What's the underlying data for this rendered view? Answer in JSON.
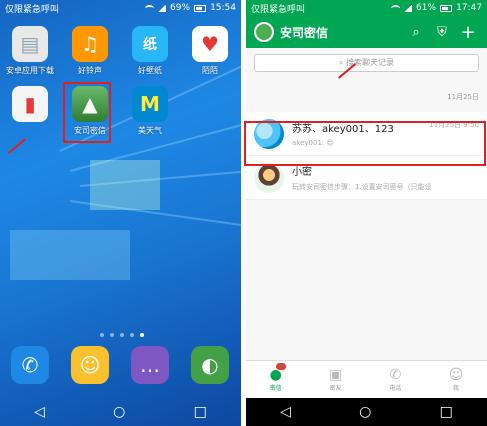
{
  "left": {
    "status": {
      "carrier": "仅限紧急呼叫",
      "battery": "69%",
      "time": "15:54"
    },
    "apps": [
      {
        "label": "安卓应用下载",
        "icon": "bag-icon",
        "color": "#e8e8e8"
      },
      {
        "label": "好铃声",
        "icon": "music-note-icon",
        "color": "#ff9800"
      },
      {
        "label": "好壁纸",
        "icon": "wallpaper-icon",
        "color": "#29b6f6"
      },
      {
        "label": "陌陌",
        "icon": "heart-icon",
        "color": "#ffffff"
      },
      {
        "label": "",
        "icon": "partial-icon",
        "color": "#f5f5f5"
      },
      {
        "label": "安司密信",
        "icon": "anzu-icon",
        "color": "#4caf50"
      },
      {
        "label": "美天气",
        "icon": "weather-icon",
        "color": "#0288d1"
      }
    ],
    "dock": [
      {
        "name": "dialer",
        "icon": "phone-icon",
        "color": "#1e88e5"
      },
      {
        "name": "contacts",
        "icon": "contacts-icon",
        "color": "#fbc02d"
      },
      {
        "name": "messages",
        "icon": "message-icon",
        "color": "#7e57c2"
      },
      {
        "name": "browser",
        "icon": "browser-icon",
        "color": "#43a047"
      }
    ],
    "page_dots": 5,
    "active_dot": 4
  },
  "right": {
    "status": {
      "carrier": "仅限紧急呼叫",
      "battery": "61%",
      "time": "17:47"
    },
    "app_title": "安司密信",
    "search_placeholder": "搜索聊天记录",
    "date_hint": "11月25日",
    "chats": [
      {
        "name": "苏苏、akey001、123",
        "preview": "akey001: 😊",
        "time": "11月25日 9:50"
      },
      {
        "name": "小密",
        "preview": "玩转安司密信步骤：1.设置安司密号（只能设",
        "time": ""
      }
    ],
    "tabs": [
      {
        "label": "密信",
        "icon": "chat-bubble-icon",
        "badge": "1"
      },
      {
        "label": "密友",
        "icon": "contact-card-icon"
      },
      {
        "label": "电话",
        "icon": "phone-icon"
      },
      {
        "label": "我",
        "icon": "person-icon"
      }
    ]
  },
  "colors": {
    "brand_green": "#00a651",
    "highlight_red": "#e02020"
  }
}
